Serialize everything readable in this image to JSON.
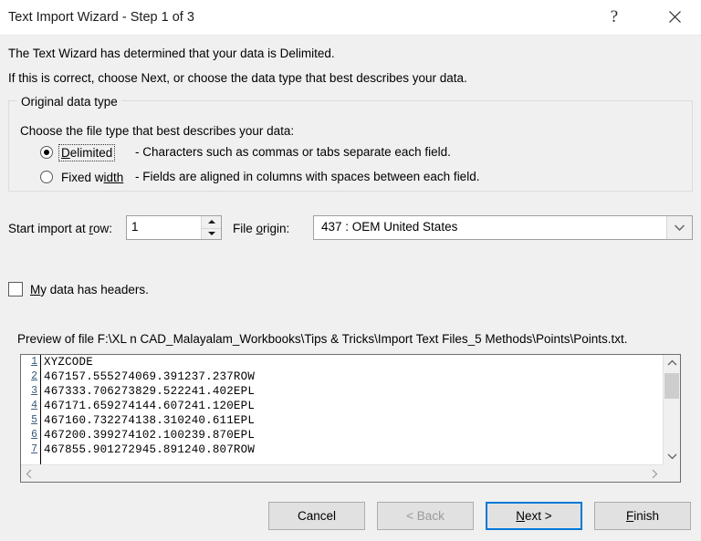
{
  "window": {
    "title": "Text Import Wizard - Step 1 of 3",
    "help_icon": "question-mark-icon",
    "close_icon": "close-icon",
    "accent_color": "#0078d7",
    "background_color": "#f0f0f0"
  },
  "intro": {
    "line1": "The Text Wizard has determined that your data is Delimited.",
    "line2": "If this is correct, choose Next, or choose the data type that best describes your data."
  },
  "original_data_type": {
    "legend": "Original data type",
    "instruction": "Choose the file type that best describes your data:",
    "options": [
      {
        "label_prefix": "D",
        "label_rest": "elimited",
        "label_full": "Delimited",
        "description": "- Characters such as commas or tabs separate each field.",
        "selected": true,
        "focused": true
      },
      {
        "label_prefix": "Fixed w",
        "label_rest": "idth",
        "label_full": "Fixed width",
        "description": "- Fields are aligned in columns with spaces between each field.",
        "selected": false,
        "focused": false
      }
    ]
  },
  "start_import": {
    "label_prefix": "Start import at ",
    "label_accel": "r",
    "label_rest": "ow:",
    "label_full": "Start import at row:",
    "value": "1",
    "spin_up_icon": "triangle-up-icon",
    "spin_down_icon": "triangle-down-icon"
  },
  "file_origin": {
    "label_prefix": "File ",
    "label_accel": "o",
    "label_rest": "rigin:",
    "label_full": "File origin:",
    "selected": "437 : OEM United States",
    "dropdown_icon": "chevron-down-icon"
  },
  "headers_checkbox": {
    "label_accel": "M",
    "label_rest": "y data has headers.",
    "label_full": "My data has headers.",
    "checked": false
  },
  "preview": {
    "label": "Preview of file F:\\XL n CAD_Malayalam_Workbooks\\Tips & Tricks\\Import Text Files_5 Methods\\Points\\Points.txt.",
    "lines": [
      {
        "num": "1",
        "text": "XYZCODE"
      },
      {
        "num": "2",
        "text": "467157.555274069.391237.237ROW"
      },
      {
        "num": "3",
        "text": "467333.706273829.522241.402EPL"
      },
      {
        "num": "4",
        "text": "467171.659274144.607241.120EPL"
      },
      {
        "num": "5",
        "text": "467160.732274138.310240.611EPL"
      },
      {
        "num": "6",
        "text": "467200.399274102.100239.870EPL"
      },
      {
        "num": "7",
        "text": "467855.901272945.891240.807ROW"
      }
    ],
    "vscroll_up_icon": "chevron-up-icon",
    "vscroll_down_icon": "chevron-down-icon",
    "hscroll_left_icon": "chevron-left-icon",
    "hscroll_right_icon": "chevron-right-icon"
  },
  "footer": {
    "cancel": "Cancel",
    "back": "< Back",
    "back_disabled": true,
    "next_prefix": "N",
    "next_rest": "ext >",
    "next_full": "Next >",
    "next_focused": true,
    "finish_prefix": "F",
    "finish_rest": "inish",
    "finish_full": "Finish"
  }
}
